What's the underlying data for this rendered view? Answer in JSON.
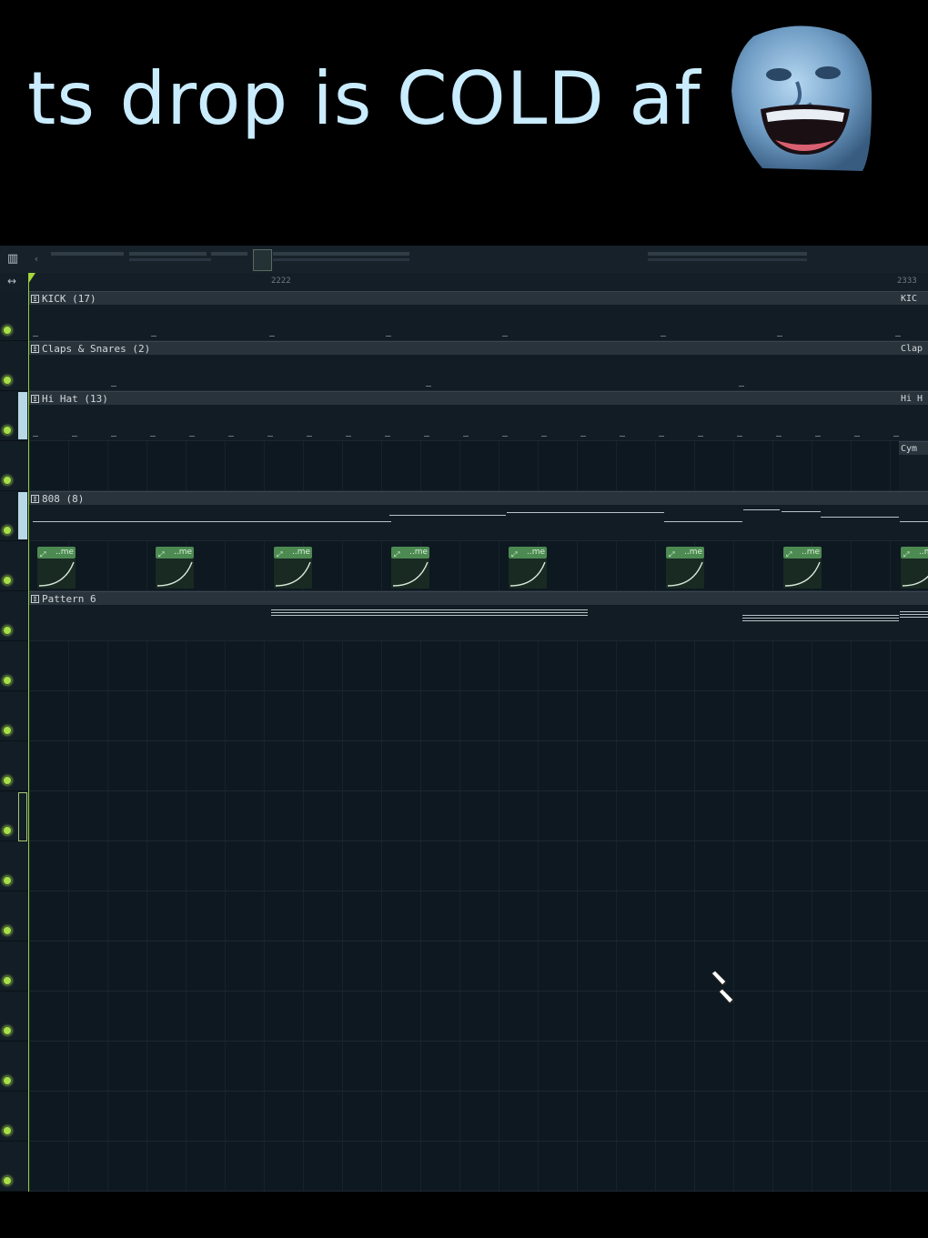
{
  "caption": "ts drop is COLD af",
  "ruler": {
    "bar_a": "2222",
    "bar_b": "2333"
  },
  "tracks": [
    {
      "label": "KICK (17)",
      "end_label": "KIC"
    },
    {
      "label": "Claps & Snares (2)",
      "end_label": "Clap"
    },
    {
      "label": "Hi Hat (13)",
      "end_label": "Hi H"
    },
    {
      "label": "",
      "end_label": "Cym"
    },
    {
      "label": "808 (8)",
      "end_label": ""
    },
    {
      "label": "",
      "end_label": ""
    },
    {
      "label": "Pattern 6",
      "end_label": ""
    }
  ],
  "automation_clip_label": "..me",
  "colors": {
    "caption": "#c9ecff",
    "led": "#a8e04a",
    "playhead": "#8fcf3a",
    "automation": "#4c8a52"
  },
  "icons": [
    "snap-icon",
    "scroll-arrows-icon",
    "pattern-icon",
    "pencil-cursor-icon",
    "automation-icon"
  ]
}
